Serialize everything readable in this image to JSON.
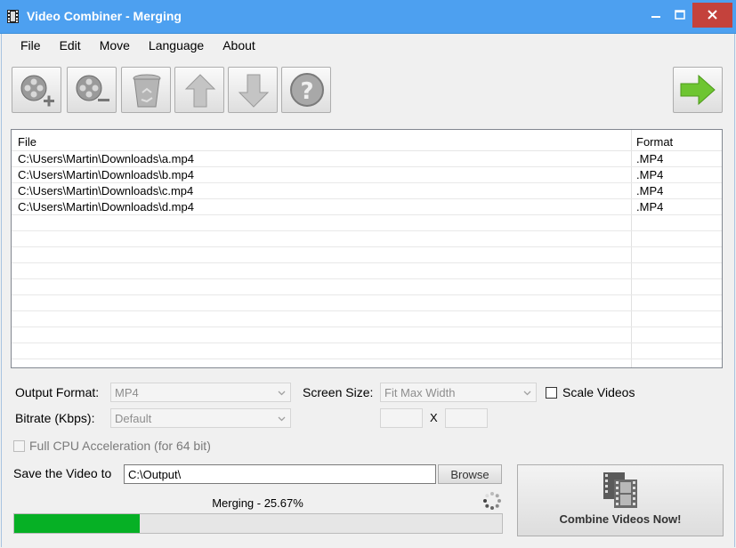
{
  "window": {
    "title": "Video Combiner - Merging",
    "controls": [
      "minimize",
      "maximize",
      "close"
    ]
  },
  "menu": [
    "File",
    "Edit",
    "Move",
    "Language",
    "About"
  ],
  "toolbar": {
    "buttons": [
      "add-video-icon",
      "remove-video-icon",
      "clear-list-icon",
      "move-up-icon",
      "move-down-icon",
      "help-icon"
    ],
    "start_button": "arrow-right-icon"
  },
  "file_list": {
    "columns": [
      "File",
      "Format"
    ],
    "rows": [
      {
        "file": "C:\\Users\\Martin\\Downloads\\a.mp4",
        "format": ".MP4"
      },
      {
        "file": "C:\\Users\\Martin\\Downloads\\b.mp4",
        "format": ".MP4"
      },
      {
        "file": "C:\\Users\\Martin\\Downloads\\c.mp4",
        "format": ".MP4"
      },
      {
        "file": "C:\\Users\\Martin\\Downloads\\d.mp4",
        "format": ".MP4"
      }
    ]
  },
  "settings": {
    "output_format_label": "Output Format:",
    "output_format_value": "MP4",
    "screen_size_label": "Screen Size:",
    "screen_size_value": "Fit Max Width",
    "scale_videos_label": "Scale Videos",
    "bitrate_label": "Bitrate (Kbps):",
    "bitrate_value": "Default",
    "size_separator": "X",
    "cpu_accel_label": "Full CPU Acceleration (for 64 bit)",
    "save_label": "Save the Video to",
    "save_path": "C:\\Output\\",
    "browse_label": "Browse"
  },
  "status": {
    "text": "Merging - 25.67%",
    "progress_percent": 25.67
  },
  "combine_button": "Combine Videos Now!",
  "colors": {
    "titlebar": "#4da0f0",
    "close": "#c4423c",
    "progress": "#06b025"
  }
}
